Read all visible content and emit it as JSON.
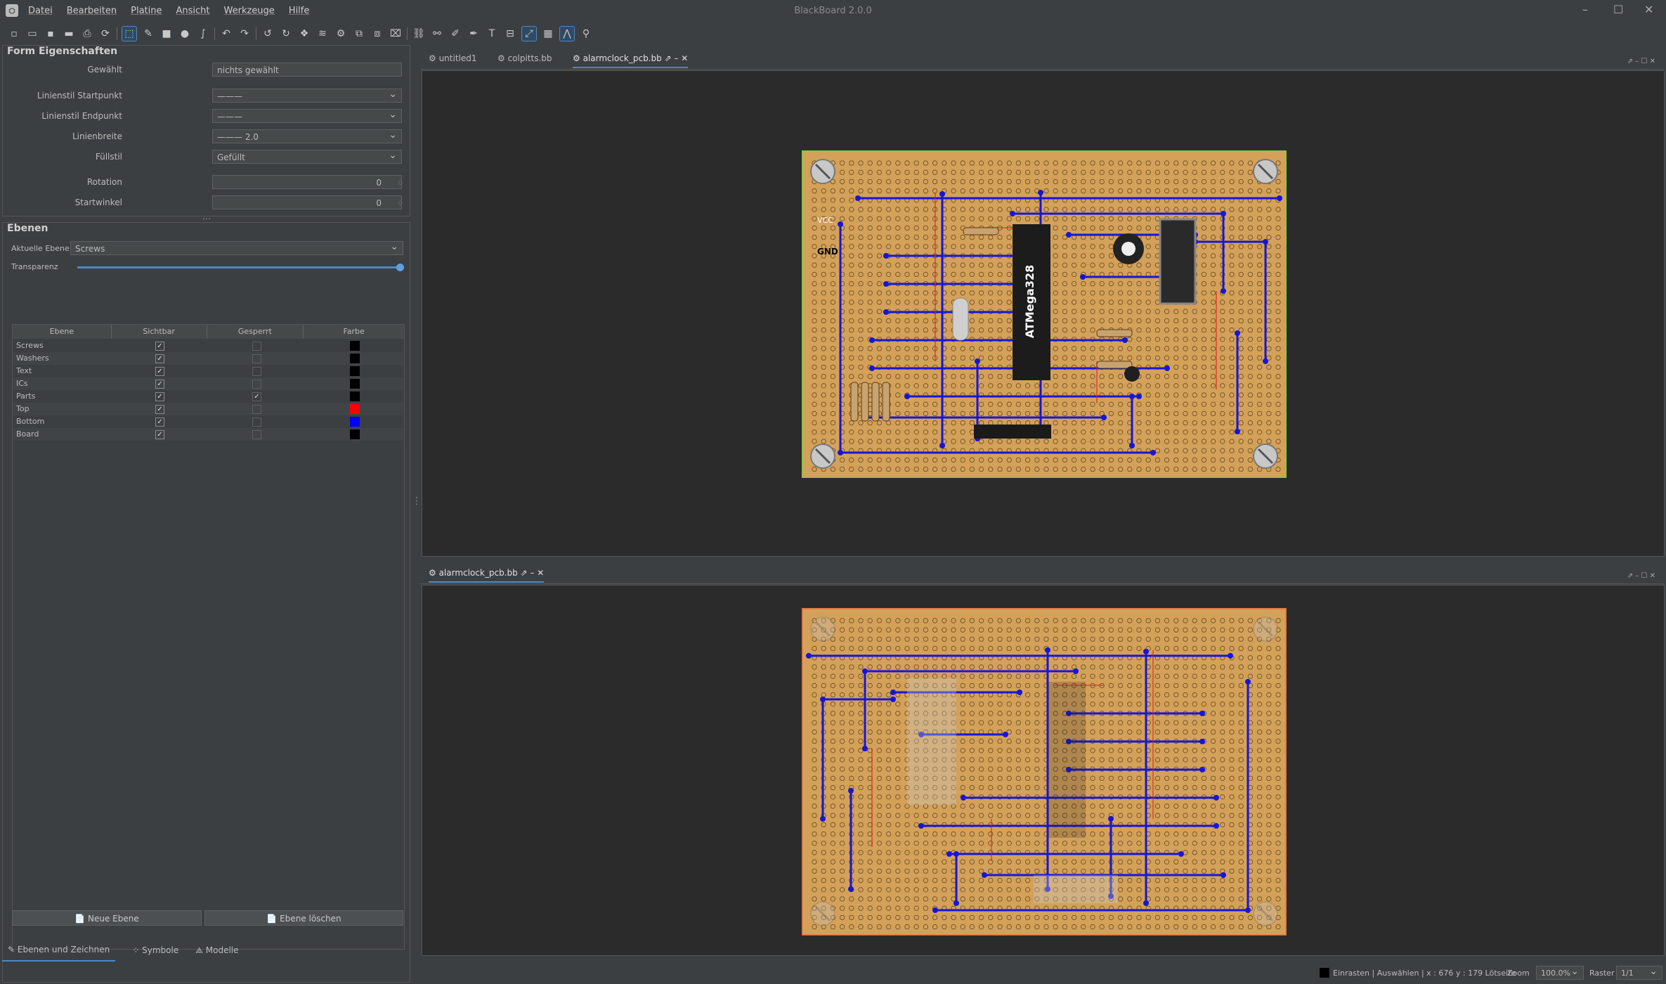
{
  "app": {
    "title": "BlackBoard 2.0.0"
  },
  "menu": [
    "Datei",
    "Bearbeiten",
    "Platine",
    "Ansicht",
    "Werkzeuge",
    "Hilfe"
  ],
  "form": {
    "title": "Form Eigenschaften",
    "rows": [
      {
        "label": "Gewählt",
        "value": "nichts gewählt"
      },
      {
        "label": "Linienstil Startpunkt",
        "value": "———"
      },
      {
        "label": "Linienstil Endpunkt",
        "value": "———"
      },
      {
        "label": "Linienbreite",
        "value": "——— 2.0"
      },
      {
        "label": "Füllstil",
        "value": "Gefüllt"
      },
      {
        "label": "Rotation",
        "value": "0"
      },
      {
        "label": "Startwinkel",
        "value": "0"
      }
    ]
  },
  "layers": {
    "title": "Ebenen",
    "current_label": "Aktuelle Ebene",
    "current_value": "Screws",
    "transparency_label": "Transparenz",
    "transparency": 1.0,
    "headers": [
      "Ebene",
      "Sichtbar",
      "Gesperrt",
      "Farbe"
    ],
    "rows": [
      {
        "name": "Screws",
        "visible": "✓",
        "locked": "",
        "color": "#000000"
      },
      {
        "name": "Washers",
        "visible": "✓",
        "locked": "",
        "color": "#000000"
      },
      {
        "name": "Text",
        "visible": "✓",
        "locked": "",
        "color": "#000000"
      },
      {
        "name": "ICs",
        "visible": "✓",
        "locked": "",
        "color": "#000000"
      },
      {
        "name": "Parts",
        "visible": "✓",
        "locked": "✓",
        "color": "#000000"
      },
      {
        "name": "Top",
        "visible": "✓",
        "locked": "",
        "color": "#ff0000"
      },
      {
        "name": "Bottom",
        "visible": "✓",
        "locked": "",
        "color": "#0000ff"
      },
      {
        "name": "Board",
        "visible": "✓",
        "locked": "",
        "color": "#000000"
      }
    ],
    "new_button": "Neue Ebene",
    "delete_button": "Ebene löschen"
  },
  "bottom_tabs": [
    "Ebenen und Zeichnen",
    "Symbole",
    "Modelle"
  ],
  "editor_top": {
    "tabs": [
      "untitled1",
      "colpitts.bb",
      "alarmclock_pcb.bb"
    ],
    "active": "alarmclock_pcb.bb"
  },
  "editor_bottom": {
    "tabs": [
      "alarmclock_pcb.bb"
    ]
  },
  "board": {
    "chip_label": "ATMega328",
    "vcc_label": "VCC",
    "gnd_label": "GND"
  },
  "status": {
    "text": "Einrasten | Auswählen | x : 676 y : 179 Lötseite",
    "zoom_label": "Zoom",
    "zoom": "100.0%",
    "grid_label": "Raster",
    "grid": "1/1"
  },
  "colors": {
    "accent": "#4a88c7",
    "board": "#d4a15a",
    "trace_blue": "#1616d6",
    "trace_red": "#e02020",
    "frame_green": "#7ccf3a"
  }
}
